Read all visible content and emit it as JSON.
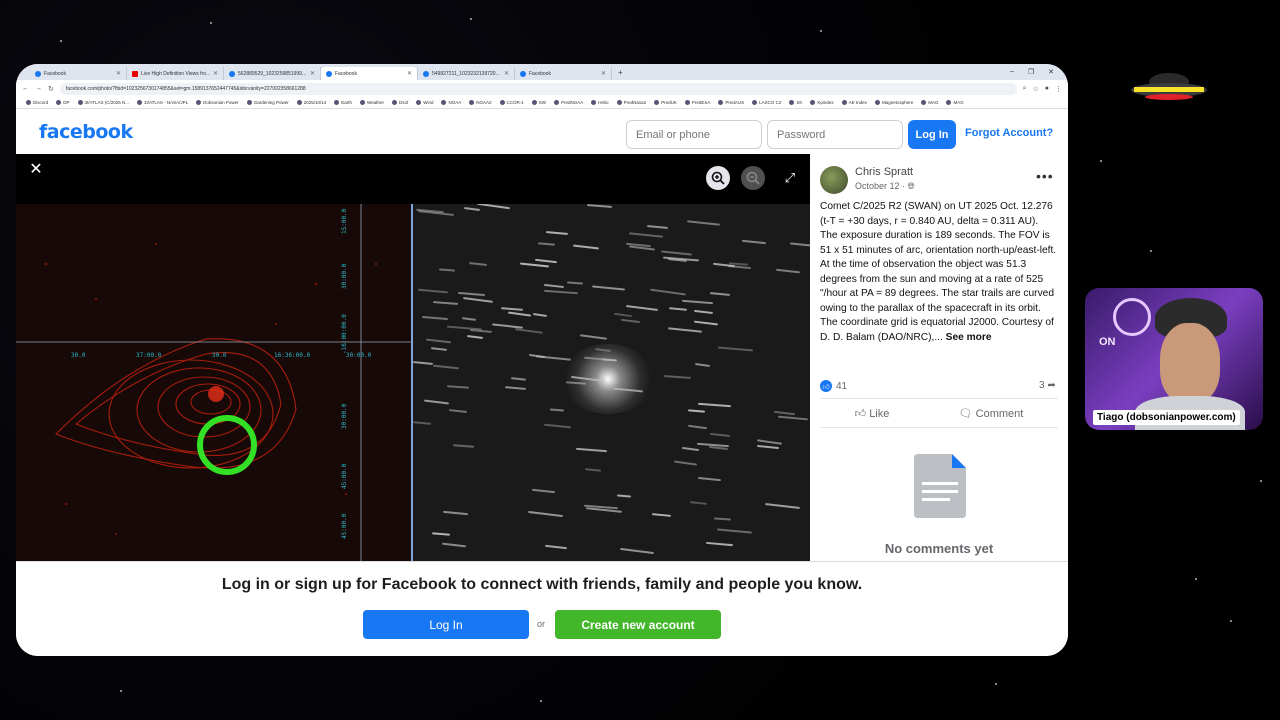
{
  "browser": {
    "tabs": [
      {
        "title": "Facebook",
        "icon": "facebook-icon",
        "active": false
      },
      {
        "title": "Live High Definition Views fro...",
        "icon": "youtube-icon",
        "active": false
      },
      {
        "title": "562889529_1023259851999...",
        "icon": "facebook-icon",
        "active": false
      },
      {
        "title": "Facebook",
        "icon": "facebook-icon",
        "active": true
      },
      {
        "title": "549827211_1023232139720...",
        "icon": "facebook-icon",
        "active": false
      },
      {
        "title": "Facebook",
        "icon": "facebook-icon",
        "active": false
      }
    ],
    "new_tab": "+",
    "url": "facebook.com/photo/?fbid=1023256730174855&set=gm.1589137652447745&idorvanity=227002358661288",
    "bookmarks": [
      "Discord",
      "DP",
      "3I/ATLAS (C/2025 N...",
      "3I/ATLAS - NASA/JPL",
      "Dobsonian Power",
      "Gardening Power",
      "2025/10/14",
      "Earth",
      "Weather",
      "Dsof",
      "Wind",
      "NOAA",
      "NOAA2",
      "CCOR-1",
      "SW",
      "PredNOAA",
      "Helio",
      "PredNasa2",
      "PredUK",
      "PredESA",
      "PredAUS",
      "LASCO C2",
      "SK",
      "Kpindex",
      "AE Index",
      "Magnetosphere",
      "MAG",
      "MAG"
    ]
  },
  "facebook_header": {
    "logo": "facebook",
    "email_placeholder": "Email or phone",
    "password_placeholder": "Password",
    "login_label": "Log In",
    "forgot_label": "Forgot Account?"
  },
  "viewer": {
    "close_icon": "close-icon",
    "zoom_in_icon": "zoom-in-icon",
    "zoom_out_icon": "zoom-out-icon",
    "fullscreen_icon": "fullscreen-icon",
    "grid_labels_top": [
      "30.0",
      "37:00.0",
      "30.0",
      "16:36:00.0",
      "30:00.0"
    ],
    "grid_labels_right": [
      "15:00.0",
      "30:00.0",
      "-16:00:00.0",
      "30:00.0",
      "45:00.0",
      "45:00.0"
    ]
  },
  "post": {
    "author": "Chris Spratt",
    "date": "October 12 · ",
    "date_icon": "globe-icon",
    "caption": "Comet C/2025 R2 (SWAN) on UT 2025 Oct. 12.276 (t-T = +30 days, r = 0.840 AU, delta = 0.311 AU). The exposure duration is 189 seconds. The FOV is 51 x 51 minutes of arc, orientation north-up/east-left. At the time of observation the object was 51.3 degrees from the sun and moving at a rate of 525 \"/hour at PA = 89 degrees. The star trails are curved owing to the parallax of the spacecraft in its orbit. The coordinate grid is equatorial J2000. Courtesy of D. D. Balam (DAO/NRC),... ",
    "see_more": "See more",
    "reaction_count": "41",
    "share_count": "3",
    "like_label": "Like",
    "comment_label": "Comment",
    "no_comments": "No comments yet"
  },
  "banner": {
    "text": "Log in or sign up for Facebook to connect with friends, family and people you know.",
    "login_label": "Log In",
    "or_label": "or",
    "create_label": "Create new account"
  },
  "overlay": {
    "webcam_name": "Tiago (dobsonianpower.com)",
    "webcam_sign": "ON"
  },
  "colors": {
    "facebook_blue": "#1877f2",
    "create_green": "#42b72a",
    "contour_red": "#d42a12",
    "target_circle": "#33e025"
  }
}
